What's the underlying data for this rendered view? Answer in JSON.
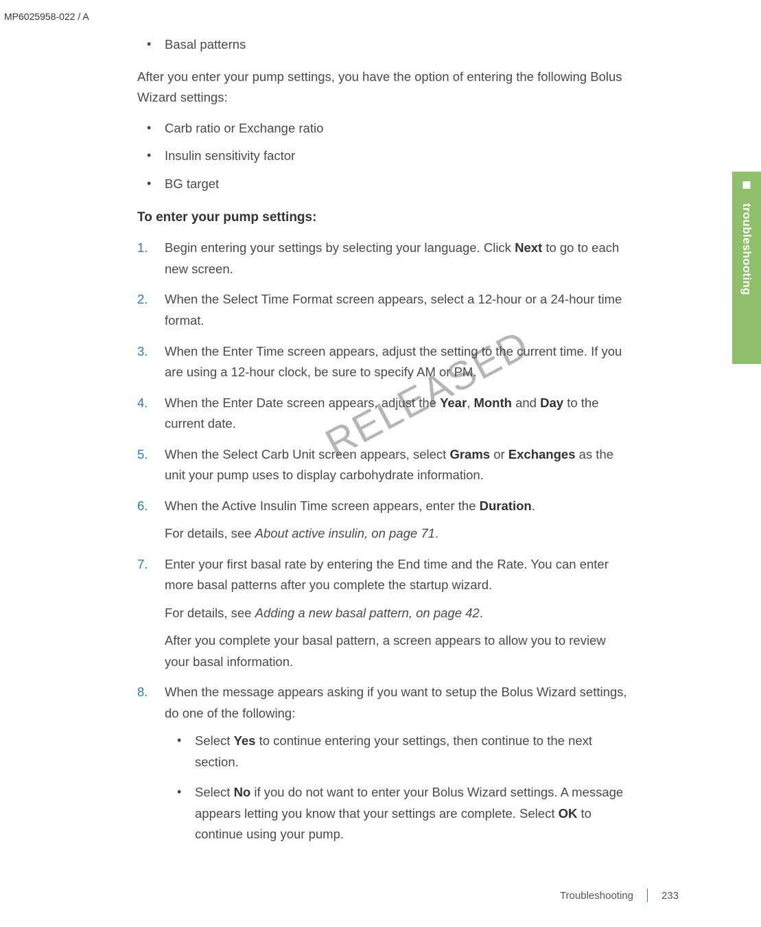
{
  "doc_id": "MP6025958-022 / A",
  "watermark": "RELEASED",
  "side_tab": {
    "label": "troubleshooting"
  },
  "footer": {
    "section": "Troubleshooting",
    "page": "233"
  },
  "bullets_top": {
    "b0": "Basal patterns"
  },
  "para1_a": "After you enter your pump settings, you have the option of entering the following Bolus Wizard settings:",
  "bullets_mid": {
    "b0": "Carb ratio or Exchange ratio",
    "b1": "Insulin sensitivity factor",
    "b2": "BG target"
  },
  "subhead": "To enter your pump settings:",
  "steps": {
    "s1": {
      "num": "1.",
      "a": "Begin entering your settings by selecting your language. Click ",
      "b": "Next",
      "c": " to go to each new screen."
    },
    "s2": {
      "num": "2.",
      "a": "When the Select Time Format screen appears, select a 12-hour or a 24-hour time format."
    },
    "s3": {
      "num": "3.",
      "a": "When the Enter Time screen appears, adjust the setting to the current time. If you are using a 12-hour clock, be sure to specify AM or PM."
    },
    "s4": {
      "num": "4.",
      "a": "When the Enter Date screen appears, adjust the ",
      "b": "Year",
      "c": ", ",
      "d": "Month",
      "e": " and ",
      "f": "Day",
      "g": " to the current date."
    },
    "s5": {
      "num": "5.",
      "a": "When the Select Carb Unit screen appears, select ",
      "b": "Grams",
      "c": " or ",
      "d": "Exchanges",
      "e": " as the unit your pump uses to display carbohydrate information."
    },
    "s6": {
      "num": "6.",
      "a": "When the Active Insulin Time screen appears, enter the ",
      "b": "Duration",
      "c": ".",
      "p2a": "For details, see ",
      "p2b": "About active insulin, on page 71",
      "p2c": "."
    },
    "s7": {
      "num": "7.",
      "a": "Enter your first basal rate by entering the End time and the Rate. You can enter more basal patterns after you complete the startup wizard.",
      "p2a": "For details, see ",
      "p2b": "Adding a new basal pattern, on page 42",
      "p2c": ".",
      "p3": "After you complete your basal pattern, a screen appears to allow you to review your basal information."
    },
    "s8": {
      "num": "8.",
      "a": "When the message appears asking if you want to setup the Bolus Wizard settings, do one of the following:",
      "sub1a": "Select ",
      "sub1b": "Yes",
      "sub1c": " to continue entering your settings, then continue to the next section.",
      "sub2a": "Select ",
      "sub2b": "No",
      "sub2c": " if you do not want to enter your Bolus Wizard settings. A message appears letting you know that your settings are complete. Select ",
      "sub2d": "OK",
      "sub2e": " to continue using your pump."
    }
  }
}
